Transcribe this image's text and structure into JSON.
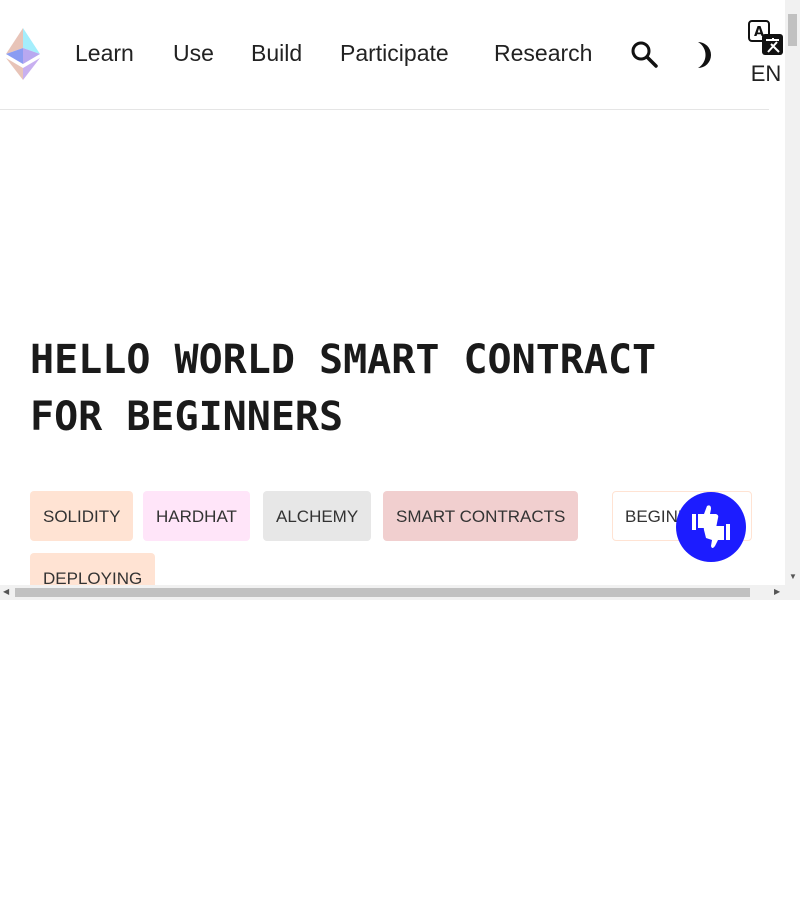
{
  "nav": {
    "links": [
      "Learn",
      "Use",
      "Build",
      "Participate",
      "Research"
    ],
    "language": "EN"
  },
  "page_title": "HELLO WORLD SMART CONTRACT FOR BEGINNERS",
  "tags": [
    "SOLIDITY",
    "HARDHAT",
    "ALCHEMY",
    "SMART CONTRACTS",
    "BEGINNER",
    "DEPLOYING"
  ],
  "colors": {
    "accent": "#1c1cff",
    "tag_solidity": "#ffe3d3",
    "tag_hardhat": "#ffe5f9",
    "tag_alchemy": "#e7e7e7",
    "tag_smart": "#f1cfcf",
    "tag_deploying": "#ffe3d3"
  }
}
